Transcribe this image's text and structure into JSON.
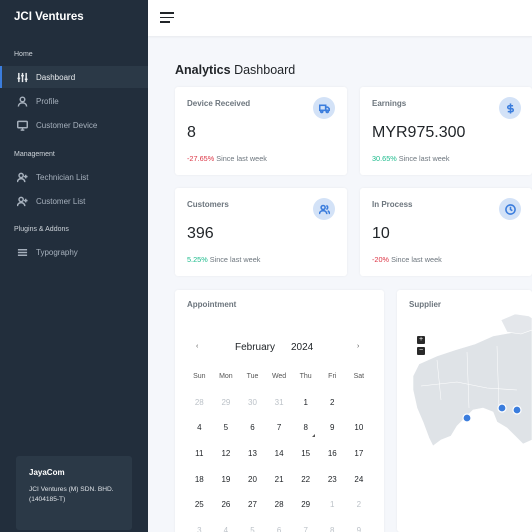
{
  "sidebar": {
    "brand": "JCI Ventures",
    "sections": [
      "Home",
      "Management",
      "Plugins & Addons"
    ],
    "items": [
      {
        "label": "Dashboard",
        "icon": "sliders-icon"
      },
      {
        "label": "Profile",
        "icon": "user-icon"
      },
      {
        "label": "Customer Device",
        "icon": "monitor-icon"
      },
      {
        "label": "Technician List",
        "icon": "user-plus-icon"
      },
      {
        "label": "Customer List",
        "icon": "user-plus-icon"
      },
      {
        "label": "Typography",
        "icon": "align-left-icon"
      }
    ],
    "card": {
      "title": "JayaCom",
      "subtitle": "JCI Ventures (M) SDN. BHD. (1404185-T)"
    }
  },
  "header": {
    "title_bold": "Analytics",
    "title_rest": " Dashboard"
  },
  "stats": [
    {
      "label": "Device Received",
      "value": "8",
      "change": "-27.65%",
      "change_type": "negative",
      "suffix": " Since last week",
      "icon": "truck-icon"
    },
    {
      "label": "Earnings",
      "value": "MYR975.300",
      "change": "30.65%",
      "change_type": "positive",
      "suffix": " Since last week",
      "icon": "dollar-icon"
    },
    {
      "label": "Customers",
      "value": "396",
      "change": "5.25%",
      "change_type": "positive",
      "suffix": " Since last week",
      "icon": "users-icon"
    },
    {
      "label": "In Process",
      "value": "10",
      "change": "-20%",
      "change_type": "negative",
      "suffix": " Since last week",
      "icon": "clock-icon"
    }
  ],
  "appointment": {
    "title": "Appointment",
    "prev": "‹",
    "next": "›",
    "month": "February",
    "year": "2024",
    "weekdays": [
      "Sun",
      "Mon",
      "Tue",
      "Wed",
      "Thu",
      "Fri",
      "Sat"
    ],
    "weeks": [
      [
        "28",
        "29",
        "30",
        "31",
        "1",
        "2",
        "3"
      ],
      [
        "4",
        "5",
        "6",
        "7",
        "8",
        "9",
        "10"
      ],
      [
        "11",
        "12",
        "13",
        "14",
        "15",
        "16",
        "17"
      ],
      [
        "18",
        "19",
        "20",
        "21",
        "22",
        "23",
        "24"
      ],
      [
        "25",
        "26",
        "27",
        "28",
        "29",
        "1",
        "2"
      ],
      [
        "3",
        "4",
        "5",
        "6",
        "7",
        "8",
        "9"
      ]
    ],
    "selected": "3"
  },
  "supplier": {
    "title": "Supplier",
    "zoom_in": "+",
    "zoom_out": "−"
  },
  "colors": {
    "primary": "#3b7ddd",
    "sidebar": "#222e3c",
    "negative": "#dc3545",
    "positive": "#1cbb8c"
  }
}
